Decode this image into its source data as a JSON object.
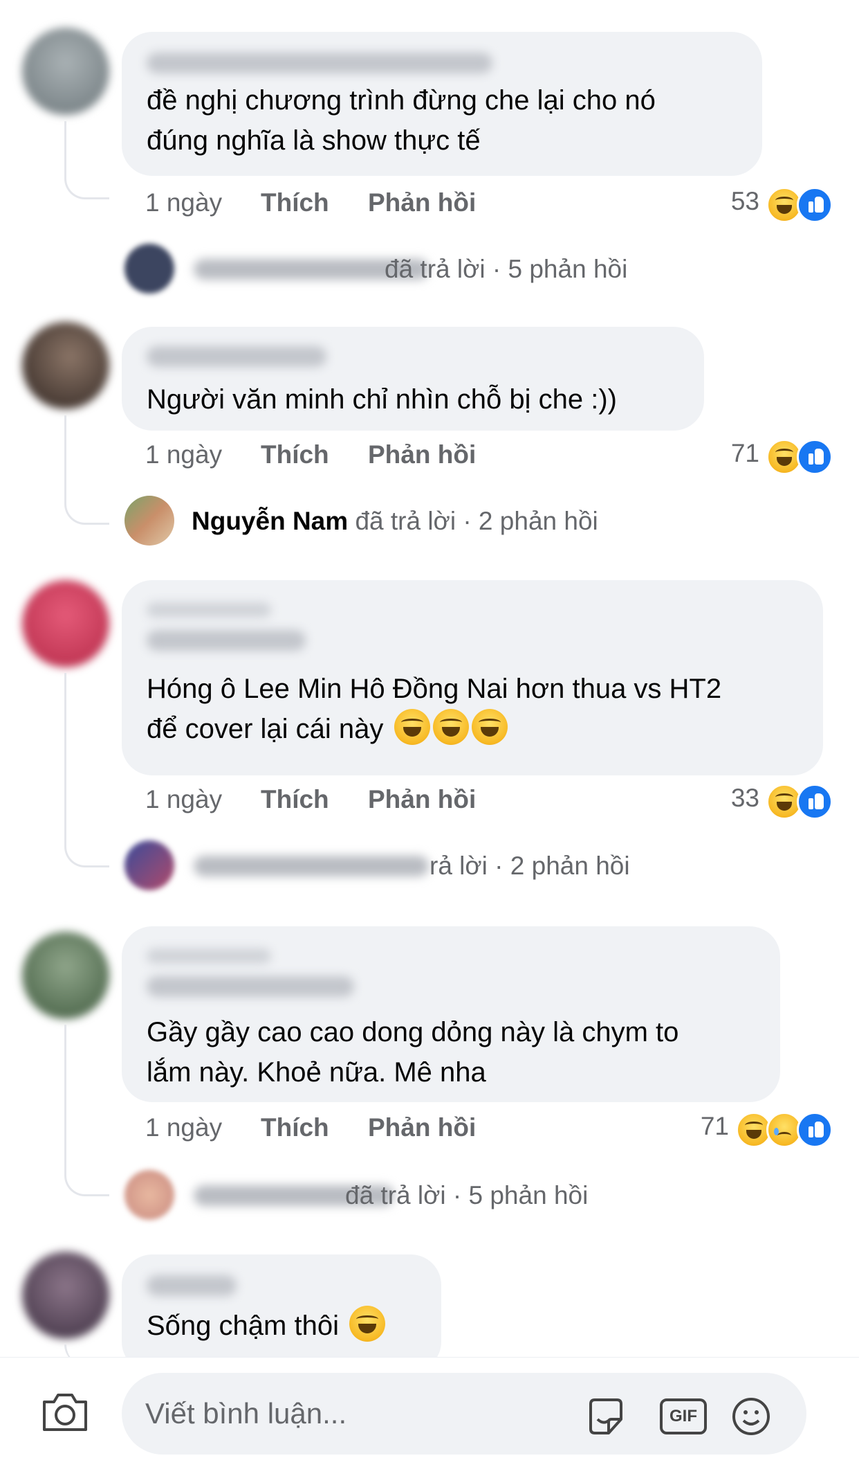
{
  "comments": [
    {
      "text_lines": [
        "đề nghị chương trình đừng  che lại cho nó",
        "đúng nghĩa là show thực tế"
      ],
      "time": "1 ngày",
      "like_label": "Thích",
      "reply_label": "Phản hồi",
      "reaction_count": "53",
      "reactions": [
        "haha-icon",
        "like-icon"
      ],
      "reply_summary": {
        "author": "",
        "text": "đã trả lời",
        "count": "· 5 phản hồi"
      },
      "avatar_color": "#7d868a"
    },
    {
      "text_lines": [
        "Người văn minh chỉ nhìn chỗ bị che :))"
      ],
      "time": "1 ngày",
      "like_label": "Thích",
      "reply_label": "Phản hồi",
      "reaction_count": "71",
      "reactions": [
        "haha-icon",
        "like-icon"
      ],
      "reply_summary": {
        "author": "Nguyễn Nam",
        "text": "đã trả lời",
        "count": "· 2 phản hồi"
      },
      "avatar_color": "#4a3b35"
    },
    {
      "text_lines": [
        "Hóng ô Lee Min Hô Đồng Nai hơn thua vs HT2",
        "để cover lại cái này"
      ],
      "time": "1 ngày",
      "like_label": "Thích",
      "reply_label": "Phản hồi",
      "reaction_count": "33",
      "reactions": [
        "haha-icon",
        "like-icon"
      ],
      "reply_summary": {
        "author": "",
        "text": "rả lời",
        "count": "· 2 phản hồi"
      },
      "avatar_color": "#c8405a"
    },
    {
      "text_lines": [
        "Gầy gầy cao cao dong dỏng này là chym to",
        "lắm này. Khoẻ nữa. Mê nha"
      ],
      "time": "1 ngày",
      "like_label": "Thích",
      "reply_label": "Phản hồi",
      "reaction_count": "71",
      "reactions": [
        "haha-icon",
        "sad-icon",
        "like-icon"
      ],
      "reply_summary": {
        "author": "",
        "text": "đã trả lời",
        "count": "· 5 phản hồi"
      },
      "avatar_color": "#5b7a5a"
    },
    {
      "text_lines": [
        "Sống chậm thôi"
      ],
      "avatar_color": "#5e4a5c"
    }
  ],
  "composer": {
    "placeholder": "Viết bình luận...",
    "icons": [
      "camera-icon",
      "sticker-icon",
      "gif-icon",
      "emoji-icon"
    ],
    "gif_label": "GIF"
  },
  "colors": {
    "bubble": "#f0f2f5",
    "meta_text": "#65676b",
    "like_blue": "#1877f2"
  }
}
